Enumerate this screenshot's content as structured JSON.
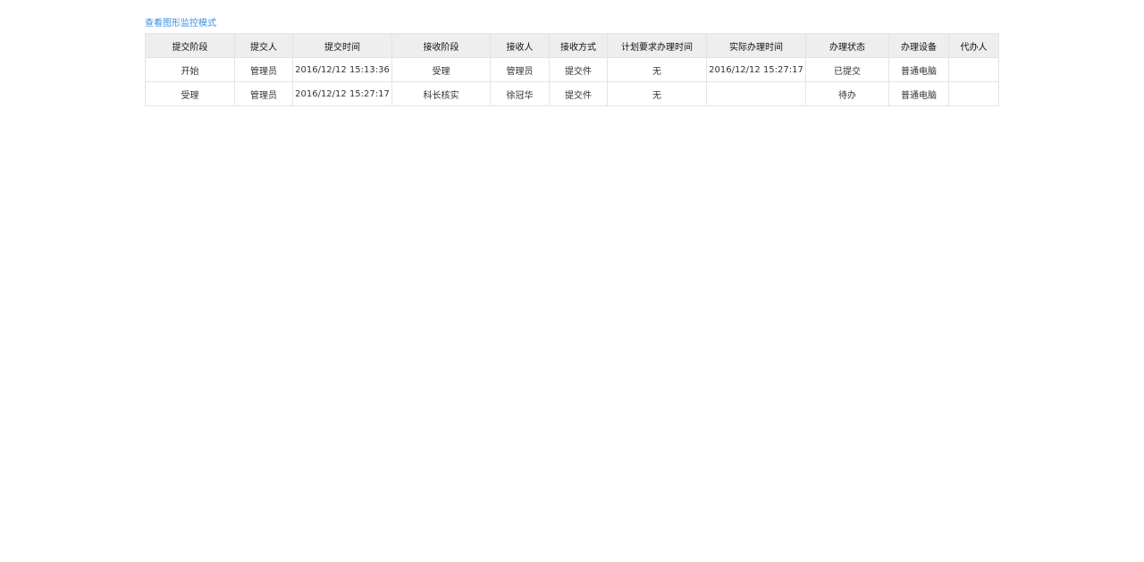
{
  "link": {
    "view_graph_mode": "查看图形监控模式"
  },
  "colors": {
    "link": "#3a8ee6",
    "header_bg": "#eeeeee",
    "border": "#e4e4e4"
  },
  "table": {
    "columns": [
      "提交阶段",
      "提交人",
      "提交时间",
      "接收阶段",
      "接收人",
      "接收方式",
      "计划要求办理时间",
      "实际办理时间",
      "办理状态",
      "办理设备",
      "代办人"
    ],
    "rows": [
      [
        "开始",
        "管理员",
        "2016/12/12 15:13:36",
        "受理",
        "管理员",
        "提交件",
        "无",
        "2016/12/12 15:27:17",
        "已提交",
        "普通电脑",
        ""
      ],
      [
        "受理",
        "管理员",
        "2016/12/12 15:27:17",
        "科长核实",
        "徐冠华",
        "提交件",
        "无",
        "",
        "待办",
        "普通电脑",
        ""
      ]
    ]
  }
}
